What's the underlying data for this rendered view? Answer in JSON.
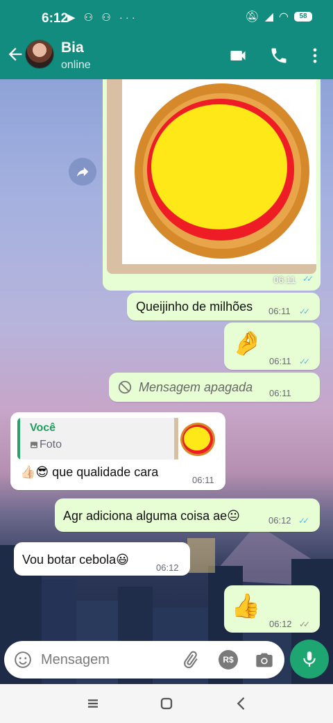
{
  "status_bar": {
    "time": "6:12",
    "battery": "58"
  },
  "header": {
    "contact_name": "Bia",
    "contact_status": "online"
  },
  "messages": [
    {
      "type": "image",
      "direction": "outgoing",
      "time": "06:11",
      "read": true
    },
    {
      "type": "text",
      "direction": "outgoing",
      "text": "Queijinho de milhões",
      "time": "06:11",
      "read": true
    },
    {
      "type": "emoji",
      "direction": "outgoing",
      "text": "🤌",
      "time": "06:11",
      "read": true
    },
    {
      "type": "deleted",
      "direction": "outgoing",
      "text": "Mensagem apagada",
      "time": "06:11"
    },
    {
      "type": "reply",
      "direction": "incoming",
      "quote_author": "Você",
      "quote_label": "Foto",
      "text": "👍🏻😎 que qualidade cara",
      "time": "06:11"
    },
    {
      "type": "text",
      "direction": "outgoing",
      "text": "Agr adiciona alguma coisa ae😐",
      "time": "06:12",
      "read": true
    },
    {
      "type": "text",
      "direction": "incoming",
      "text": "Vou botar cebola😃",
      "time": "06:12"
    },
    {
      "type": "emoji",
      "direction": "outgoing",
      "text": "👍",
      "time": "06:12",
      "read": false
    }
  ],
  "input": {
    "placeholder": "Mensagem",
    "currency_label": "R$"
  },
  "colors": {
    "header": "#128C7E",
    "outgoing_bubble": "#e7fed4",
    "incoming_bubble": "#ffffff",
    "accent": "#1ea672",
    "read_ticks": "#53bdeb"
  }
}
